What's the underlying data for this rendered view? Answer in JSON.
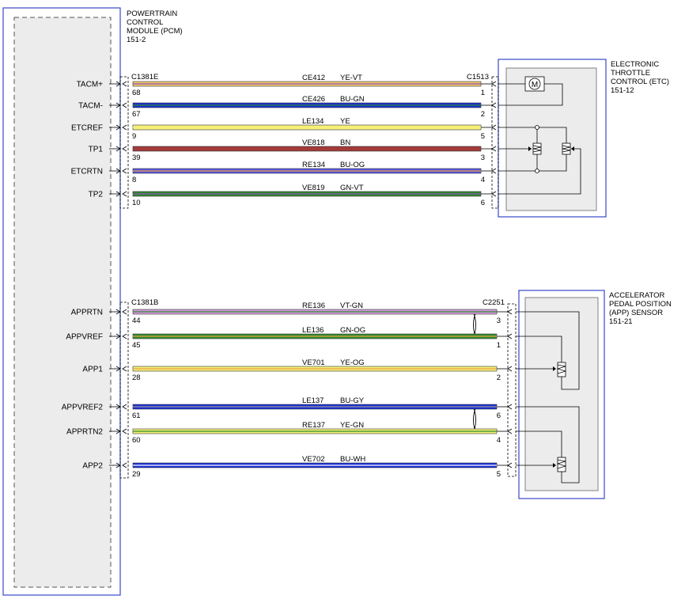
{
  "pcm": {
    "title_lines": [
      "POWERTRAIN",
      "CONTROL",
      "MODULE (PCM)",
      "151-2"
    ],
    "connector_top": "C1381E",
    "connector_bottom": "C1381B"
  },
  "etc": {
    "title_lines": [
      "ELECTRONIC",
      "THROTTLE",
      "CONTROL (ETC)",
      "151-12"
    ],
    "connector": "C1513",
    "motor_symbol": "M"
  },
  "app": {
    "title_lines": [
      "ACCELERATOR",
      "PEDAL POSITION",
      "(APP) SENSOR",
      "151-21"
    ],
    "connector": "C2251"
  },
  "wires": [
    {
      "signal": "TACM+",
      "pcm_pin": "68",
      "circuit": "CE412",
      "color_code": "YE-VT",
      "end_pin": "1",
      "fill": "#f3c96b",
      "stripe": "#8b4fb8"
    },
    {
      "signal": "TACM-",
      "pcm_pin": "67",
      "circuit": "CE426",
      "color_code": "BU-GN",
      "end_pin": "2",
      "fill": "#1b2fd6",
      "stripe": "#2a8a2a"
    },
    {
      "signal": "ETCREF",
      "pcm_pin": "9",
      "circuit": "LE134",
      "color_code": "YE",
      "end_pin": "5",
      "fill": "#f4f07a",
      "stripe": "#f4f07a"
    },
    {
      "signal": "TP1",
      "pcm_pin": "39",
      "circuit": "VE818",
      "color_code": "BN",
      "end_pin": "3",
      "fill": "#a33a3a",
      "stripe": "#a33a3a"
    },
    {
      "signal": "ETCRTN",
      "pcm_pin": "8",
      "circuit": "RE134",
      "color_code": "BU-OG",
      "end_pin": "4",
      "fill": "#5a55e0",
      "stripe": "#e8a040"
    },
    {
      "signal": "TP2",
      "pcm_pin": "10",
      "circuit": "VE819",
      "color_code": "GN-VT",
      "end_pin": "6",
      "fill": "#2f8a2f",
      "stripe": "#8b4fb8"
    },
    {
      "signal": "APPRTN",
      "pcm_pin": "44",
      "circuit": "RE136",
      "color_code": "VT-GN",
      "end_pin": "3",
      "fill": "#d79adf",
      "stripe": "#2a8a2a"
    },
    {
      "signal": "APPVREF",
      "pcm_pin": "45",
      "circuit": "LE136",
      "color_code": "GN-OG",
      "end_pin": "1",
      "fill": "#2f8a2f",
      "stripe": "#e8a040"
    },
    {
      "signal": "APP1",
      "pcm_pin": "28",
      "circuit": "VE701",
      "color_code": "YE-OG",
      "end_pin": "2",
      "fill": "#f4f07a",
      "stripe": "#e8a040"
    },
    {
      "signal": "APPVREF2",
      "pcm_pin": "61",
      "circuit": "LE137",
      "color_code": "BU-GY",
      "end_pin": "6",
      "fill": "#1b2fd6",
      "stripe": "#999999"
    },
    {
      "signal": "APPRTN2",
      "pcm_pin": "60",
      "circuit": "RE137",
      "color_code": "YE-GN",
      "end_pin": "4",
      "fill": "#f4f07a",
      "stripe": "#2a8a2a"
    },
    {
      "signal": "APP2",
      "pcm_pin": "29",
      "circuit": "VE702",
      "color_code": "BU-WH",
      "end_pin": "5",
      "fill": "#1b2fd6",
      "stripe": "#ffffff"
    }
  ]
}
